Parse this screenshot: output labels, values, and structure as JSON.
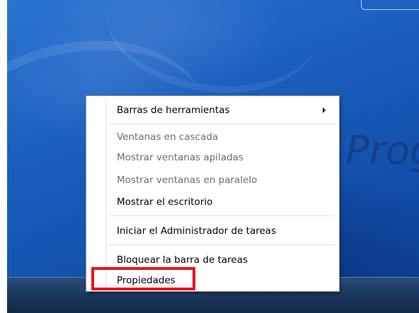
{
  "wallpaper": {
    "text": "Prog"
  },
  "menu": {
    "items": [
      {
        "label": "Barras de herramientas",
        "submenu": true
      },
      {
        "label": "Ventanas en cascada",
        "enabled": false
      },
      {
        "label": "Mostrar ventanas apiladas",
        "enabled": false
      },
      {
        "label": "Mostrar ventanas en paralelo",
        "enabled": false
      },
      {
        "label": "Mostrar el escritorio",
        "enabled": true
      },
      {
        "label": "Iniciar el Administrador de tareas",
        "enabled": true
      },
      {
        "label": "Bloquear la barra de tareas",
        "enabled": true
      },
      {
        "label": "Propiedades",
        "enabled": true,
        "highlighted": true
      }
    ]
  },
  "colors": {
    "highlight_border": "#e8141c",
    "disabled_text": "#6d6d6d",
    "desktop_blue": "#1c5fc0",
    "taskbar": "#1e3a62"
  },
  "icons": [
    "submenu-arrow-icon"
  ]
}
